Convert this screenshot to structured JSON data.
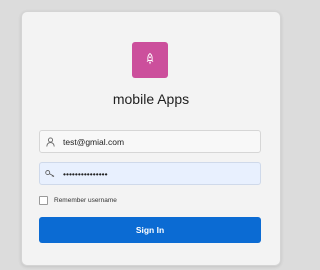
{
  "app": {
    "title": "mobile Apps",
    "logo_icon": "rocket-icon",
    "logo_color": "#cc4f9c"
  },
  "login": {
    "username_value": "test@gmial.com",
    "username_icon": "user-icon",
    "password_value": "•••••••••••••••",
    "password_icon": "key-icon",
    "remember_label": "Remember username",
    "remember_checked": false,
    "signin_label": "Sign In",
    "signin_color": "#0b6bd3"
  }
}
